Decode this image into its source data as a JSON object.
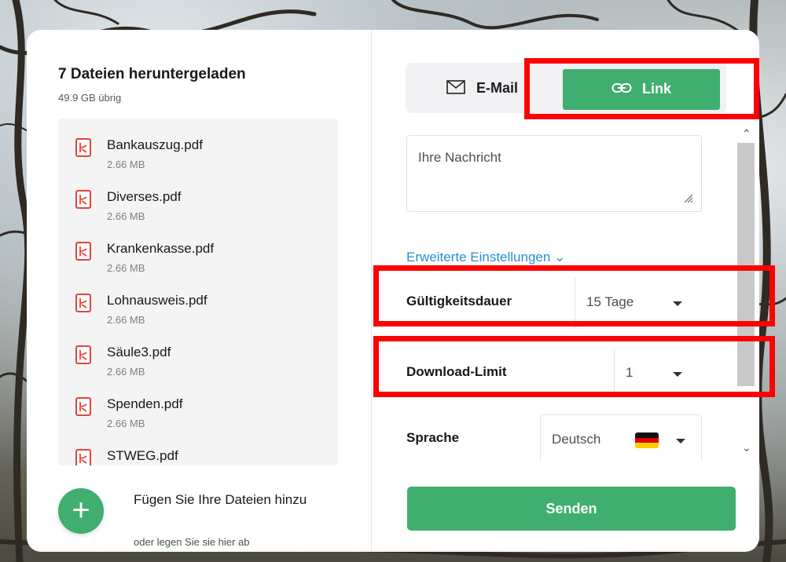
{
  "left_panel": {
    "title": "7 Dateien heruntergeladen",
    "subtitle": "49.9 GB übrig",
    "files": [
      {
        "name": "Bankauszug.pdf",
        "size": "2.66 MB"
      },
      {
        "name": "Diverses.pdf",
        "size": "2.66 MB"
      },
      {
        "name": "Krankenkasse.pdf",
        "size": "2.66 MB"
      },
      {
        "name": "Lohnausweis.pdf",
        "size": "2.66 MB"
      },
      {
        "name": "Säule3.pdf",
        "size": "2.66 MB"
      },
      {
        "name": "Spenden.pdf",
        "size": "2.66 MB"
      },
      {
        "name": "STWEG.pdf",
        "size": ""
      }
    ],
    "add_label": "Fügen Sie Ihre Dateien hinzu",
    "add_hint": "oder legen Sie sie hier ab",
    "add_icon": "plus-icon"
  },
  "right_panel": {
    "tabs": {
      "email_label": "E-Mail",
      "link_label": "Link",
      "active": "Link"
    },
    "message_placeholder": "Ihre Nachricht",
    "advanced_label": "Erweiterte Einstellungen",
    "validity": {
      "label": "Gültigkeitsdauer",
      "value": "15 Tage"
    },
    "download_limit": {
      "label": "Download-Limit",
      "value": "1"
    },
    "language": {
      "label": "Sprache",
      "value": "Deutsch",
      "flag": "german-flag-icon"
    },
    "send_label": "Senden"
  },
  "colors": {
    "accent_green": "#3fae6e",
    "link_blue": "#2a8dd6",
    "highlight_red": "#ff0000",
    "pdf_red": "#e2443b"
  }
}
